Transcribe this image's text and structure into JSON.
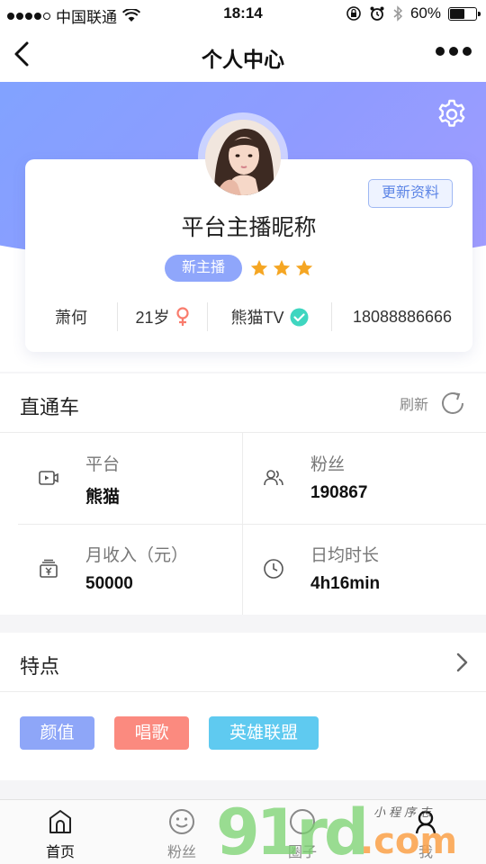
{
  "status_bar": {
    "carrier": "中国联通",
    "time": "18:14",
    "battery_text": "60%",
    "battery_level": 0.6,
    "signal_bars": 4
  },
  "nav": {
    "title": "个人中心"
  },
  "profile": {
    "update_label": "更新资料",
    "nickname": "平台主播昵称",
    "level_badge": "新主播",
    "stars": 3,
    "real_name": "萧何",
    "age": "21岁",
    "gender_icon": "female-icon",
    "platform": "熊猫TV",
    "phone": "18088886666"
  },
  "express": {
    "title": "直通车",
    "refresh_label": "刷新",
    "stats": [
      {
        "icon": "video-icon",
        "label": "平台",
        "value": "熊猫"
      },
      {
        "icon": "users-icon",
        "label": "粉丝",
        "value": "190867"
      },
      {
        "icon": "yen-wallet-icon",
        "label": "月收入（元）",
        "value": "50000"
      },
      {
        "icon": "clock-icon",
        "label": "日均时长",
        "value": "4h16min"
      }
    ]
  },
  "features": {
    "title": "特点",
    "tags": [
      {
        "label": "颜值",
        "color": "#8ea6f8"
      },
      {
        "label": "唱歌",
        "color": "#fb8a7f"
      },
      {
        "label": "英雄联盟",
        "color": "#5fcaf0"
      }
    ]
  },
  "tabbar": {
    "items": [
      {
        "label": "首页",
        "icon": "home-icon",
        "active": true
      },
      {
        "label": "粉丝",
        "icon": "smile-icon",
        "active": false
      },
      {
        "label": "圈子",
        "icon": "circle-icon",
        "active": false
      },
      {
        "label": "我",
        "icon": "user-icon",
        "active": false
      }
    ]
  },
  "watermark": {
    "big": "91rd",
    "com": ".com",
    "small": "小程序志"
  },
  "colors": {
    "accent": "#8fa6fb",
    "star": "#f5a623",
    "verified": "#3fd6c0",
    "female": "#f97c6d"
  }
}
